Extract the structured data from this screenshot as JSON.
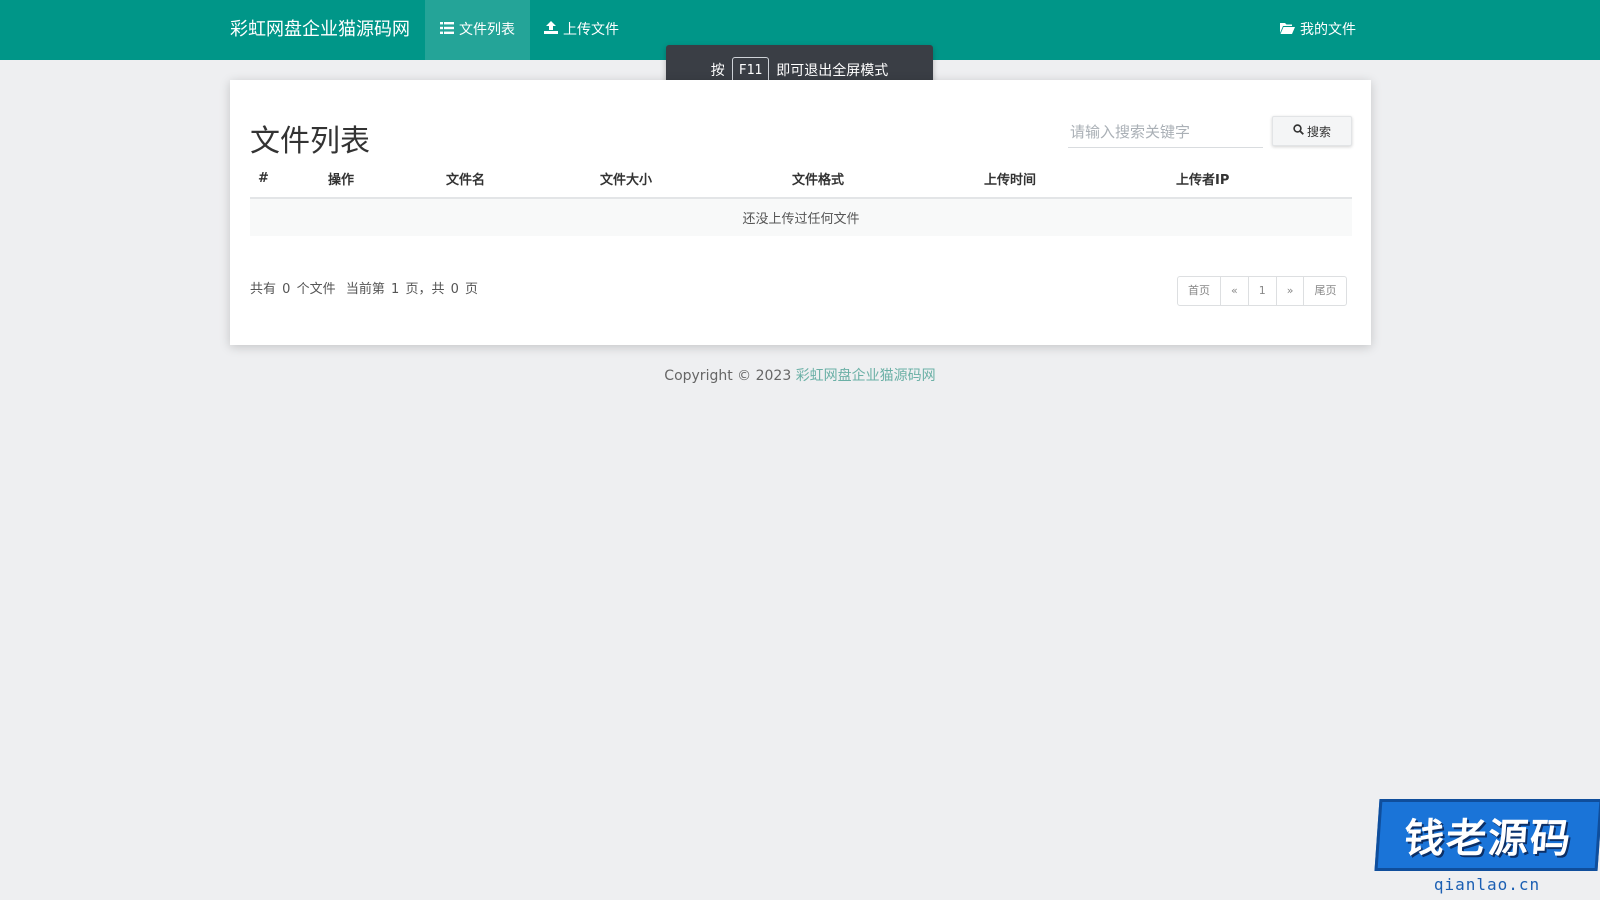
{
  "navbar": {
    "brand": "彩虹网盘企业猫源码网",
    "items": [
      {
        "label": "文件列表",
        "icon": "list-icon"
      },
      {
        "label": "上传文件",
        "icon": "upload-icon"
      }
    ],
    "right_item": {
      "label": "我的文件",
      "icon": "folder-open-icon"
    },
    "color": "#009688"
  },
  "toast": {
    "prefix": "按",
    "key": "F11",
    "suffix": "即可退出全屏模式"
  },
  "panel": {
    "title": "文件列表",
    "search": {
      "placeholder": "请输入搜索关键字",
      "button_label": "搜索",
      "button_icon": "search-icon"
    }
  },
  "table": {
    "columns": [
      "#",
      "操作",
      "文件名",
      "文件大小",
      "文件格式",
      "上传时间",
      "上传者IP"
    ],
    "empty_message": "还没上传过任何文件"
  },
  "summary": {
    "total_prefix": "共有",
    "total_count": "0",
    "total_suffix": "个文件",
    "current_prefix": "当前第",
    "current_page": "1",
    "current_suffix": "页，共",
    "pages": "0",
    "pages_suffix": "页"
  },
  "pagination": [
    "首页",
    "«",
    "1",
    "»",
    "尾页"
  ],
  "footer": {
    "text": "Copyright © 2023 ",
    "link": "彩虹网盘企业猫源码网"
  },
  "watermark": {
    "title": "钱老源码",
    "url": "qianlao.cn"
  }
}
